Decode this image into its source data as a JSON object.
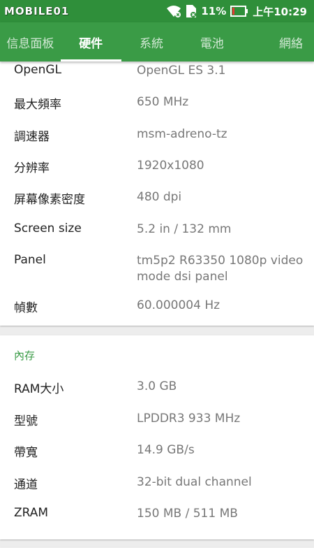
{
  "status_bar": {
    "watermark": "MOBILE01",
    "battery": "11%",
    "time": "上午10:29"
  },
  "tabs": [
    {
      "label": "信息面板"
    },
    {
      "label": "硬件"
    },
    {
      "label": "系統"
    },
    {
      "label": "電池"
    },
    {
      "label": "網絡"
    }
  ],
  "gpu": {
    "rows": [
      {
        "label": "OpenGL",
        "value": "OpenGL ES 3.1"
      },
      {
        "label": "最大頻率",
        "value": "650 MHz"
      },
      {
        "label": "調速器",
        "value": "msm-adreno-tz"
      },
      {
        "label": "分辨率",
        "value": "1920x1080"
      },
      {
        "label": "屏幕像素密度",
        "value": "480 dpi"
      },
      {
        "label": "Screen size",
        "value": "5.2 in / 132 mm"
      },
      {
        "label": "Panel",
        "value": "tm5p2 R63350 1080p video mode dsi panel"
      },
      {
        "label": "幀數",
        "value": "60.000004 Hz"
      }
    ]
  },
  "memory": {
    "title": "內存",
    "rows": [
      {
        "label": "RAM大小",
        "value": "3.0 GB"
      },
      {
        "label": "型號",
        "value": "LPDDR3 933 MHz"
      },
      {
        "label": "帶寬",
        "value": "14.9 GB/s"
      },
      {
        "label": "通道",
        "value": "32-bit dual channel"
      },
      {
        "label": "ZRAM",
        "value": "150 MB / 511 MB"
      }
    ]
  }
}
